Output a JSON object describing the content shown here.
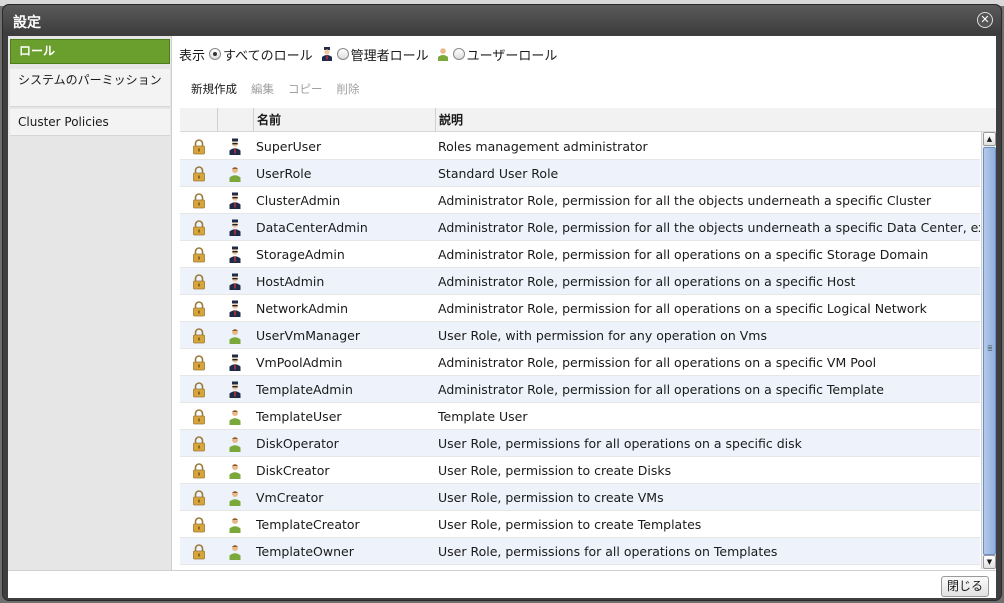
{
  "dialog": {
    "title": "設定",
    "close_label": "閉じる"
  },
  "sidebar": {
    "items": [
      {
        "label": "ロール"
      },
      {
        "label": "システムのパーミッション"
      },
      {
        "label": "Cluster Policies"
      }
    ]
  },
  "filter": {
    "label": "表示",
    "options": [
      {
        "label": "すべてのロール",
        "checked": true
      },
      {
        "label": "管理者ロール",
        "checked": false
      },
      {
        "label": "ユーザーロール",
        "checked": false
      }
    ]
  },
  "toolbar": {
    "new_label": "新規作成",
    "edit_label": "編集",
    "copy_label": "コピー",
    "delete_label": "削除"
  },
  "table": {
    "headers": [
      "名前",
      "説明"
    ],
    "rows": [
      {
        "type": "admin",
        "name": "SuperUser",
        "description": "Roles management administrator"
      },
      {
        "type": "user",
        "name": "UserRole",
        "description": "Standard User Role"
      },
      {
        "type": "admin",
        "name": "ClusterAdmin",
        "description": "Administrator Role, permission for all the objects underneath a specific Cluster"
      },
      {
        "type": "admin",
        "name": "DataCenterAdmin",
        "description": "Administrator Role, permission for all the objects underneath a specific Data Center, except St"
      },
      {
        "type": "admin",
        "name": "StorageAdmin",
        "description": "Administrator Role, permission for all operations on a specific Storage Domain"
      },
      {
        "type": "admin",
        "name": "HostAdmin",
        "description": "Administrator Role, permission for all operations on a specific Host"
      },
      {
        "type": "admin",
        "name": "NetworkAdmin",
        "description": "Administrator Role, permission for all operations on a specific Logical Network"
      },
      {
        "type": "user",
        "name": "UserVmManager",
        "description": "User Role, with permission for any operation on Vms"
      },
      {
        "type": "admin",
        "name": "VmPoolAdmin",
        "description": "Administrator Role, permission for all operations on a specific VM Pool"
      },
      {
        "type": "admin",
        "name": "TemplateAdmin",
        "description": "Administrator Role, permission for all operations on a specific Template"
      },
      {
        "type": "user",
        "name": "TemplateUser",
        "description": "Template User"
      },
      {
        "type": "user",
        "name": "DiskOperator",
        "description": "User Role, permissions for all operations on a specific disk"
      },
      {
        "type": "user",
        "name": "DiskCreator",
        "description": "User Role, permission to create Disks"
      },
      {
        "type": "user",
        "name": "VmCreator",
        "description": "User Role, permission to create VMs"
      },
      {
        "type": "user",
        "name": "TemplateCreator",
        "description": "User Role, permission to create Templates"
      },
      {
        "type": "user",
        "name": "TemplateOwner",
        "description": "User Role, permissions for all operations on Templates"
      }
    ]
  },
  "colors": {
    "accent_active": "#6a9f2e",
    "row_alt": "#eef3fb",
    "admin_icon": "#1e2a4a",
    "user_icon": "#7aa83a",
    "lock_icon": "#d8a53a"
  },
  "icons": {
    "lock": "lock-icon",
    "admin": "admin-role-icon",
    "user": "user-role-icon"
  }
}
